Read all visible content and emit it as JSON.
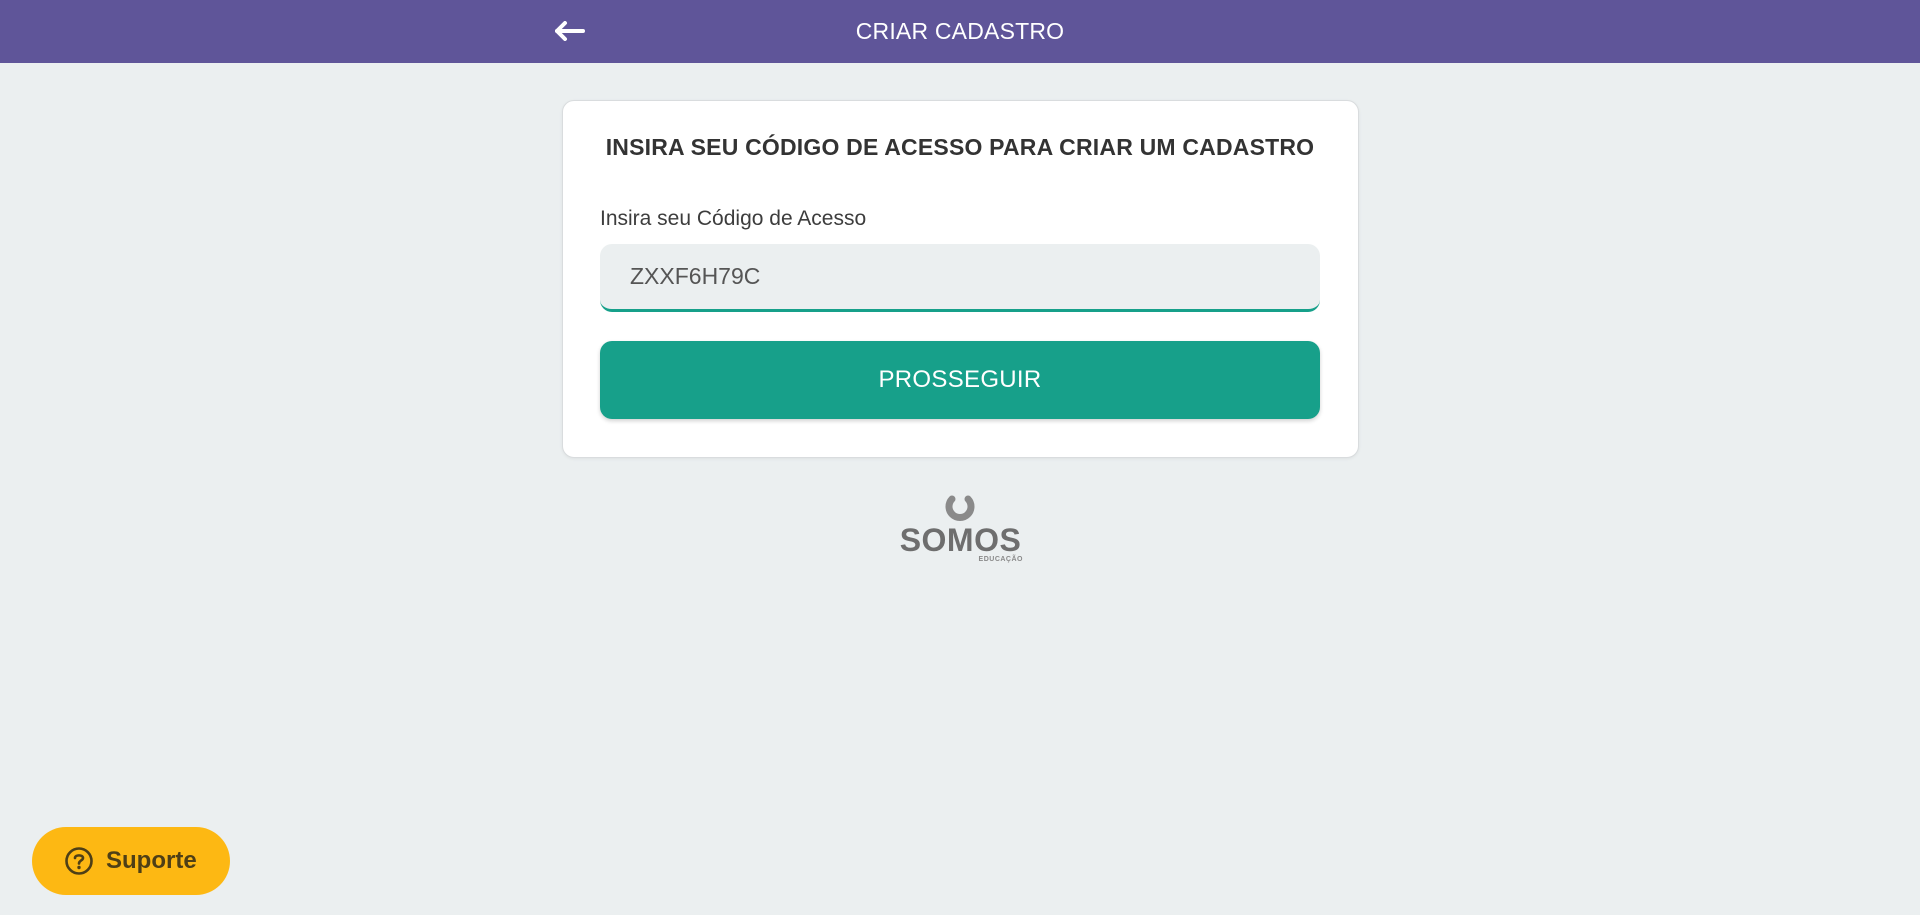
{
  "header": {
    "title": "CRIAR CADASTRO",
    "back_icon": "arrow-left-icon"
  },
  "card": {
    "heading": "INSIRA SEU CÓDIGO DE ACESSO PARA CRIAR UM CADASTRO",
    "field_label": "Insira seu Código de Acesso",
    "code_value": "ZXXF6H79C",
    "button_label": "PROSSEGUIR"
  },
  "logo": {
    "name": "SOMOS",
    "sub": "EDUCAÇÃO"
  },
  "support": {
    "label": "Suporte",
    "icon": "question-circle-icon"
  },
  "colors": {
    "header": "#5f5599",
    "background": "#ebeff0",
    "primary": "#17a08a",
    "support": "#fdb813"
  }
}
